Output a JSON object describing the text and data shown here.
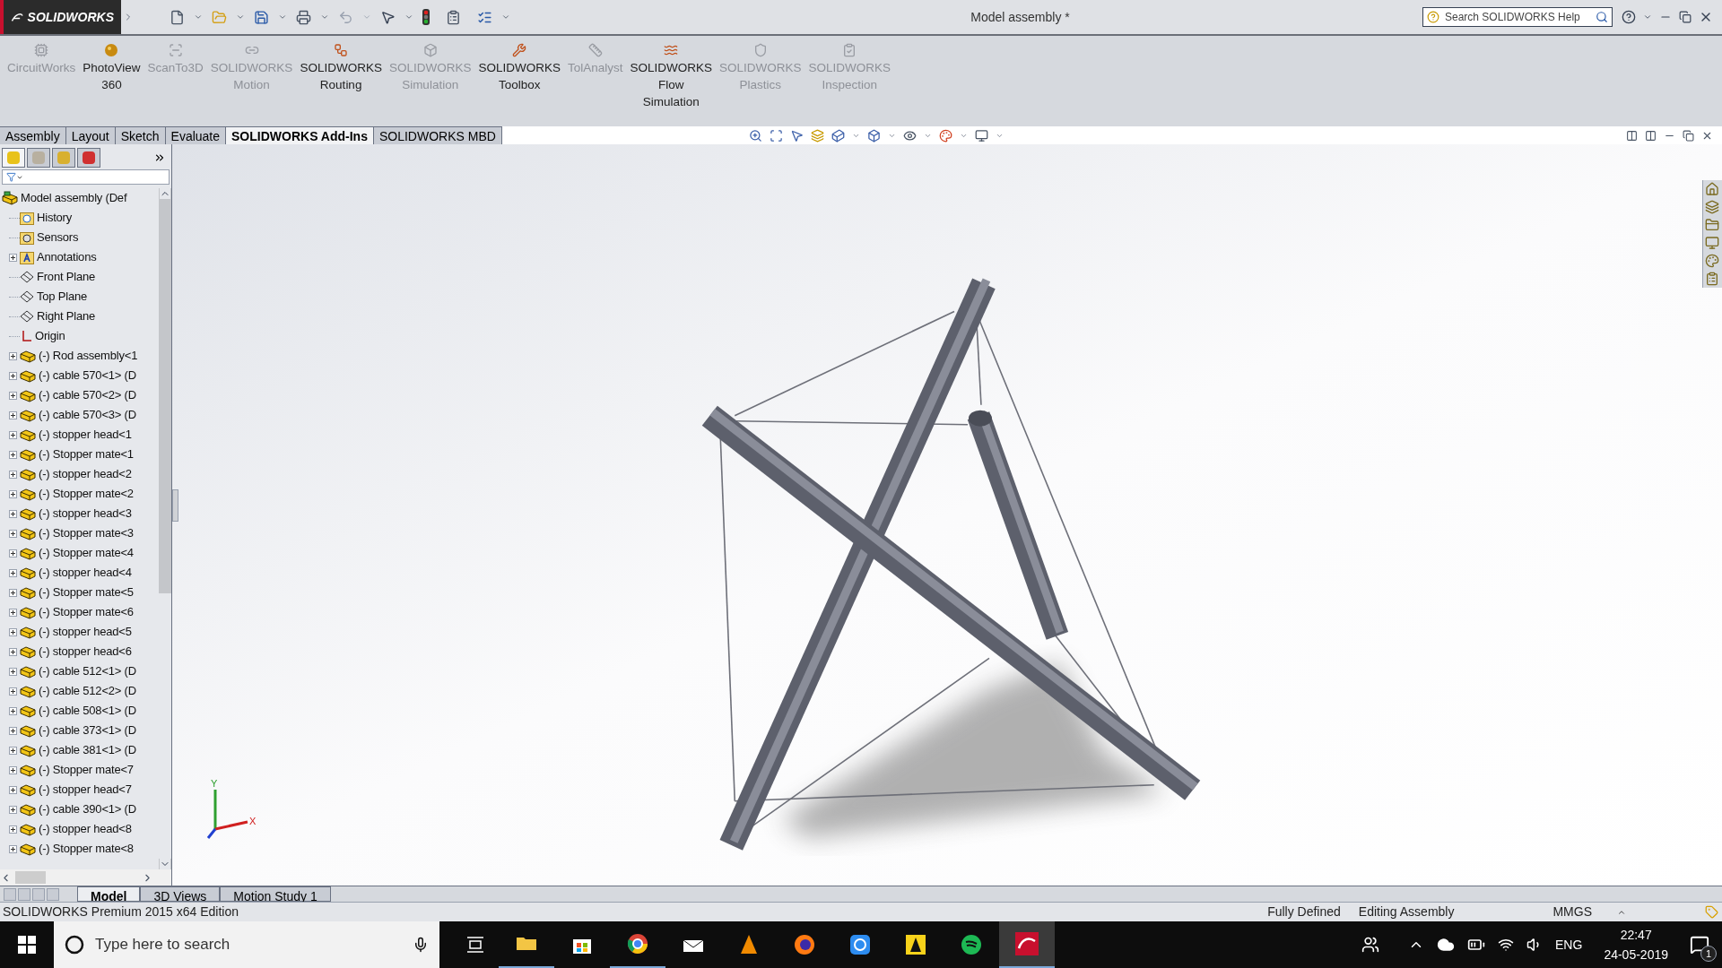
{
  "app": {
    "logo": "SOLIDWORKS"
  },
  "window": {
    "title": "Model assembly *"
  },
  "help_search": {
    "placeholder": "Search SOLIDWORKS Help"
  },
  "ribbon": [
    {
      "lines": [
        "CircuitWorks"
      ],
      "enabled": false
    },
    {
      "lines": [
        "PhotoView",
        "360"
      ],
      "enabled": true
    },
    {
      "lines": [
        "ScanTo3D"
      ],
      "enabled": false
    },
    {
      "lines": [
        "SOLIDWORKS",
        "Motion"
      ],
      "enabled": false
    },
    {
      "lines": [
        "SOLIDWORKS",
        "Routing"
      ],
      "enabled": true
    },
    {
      "lines": [
        "SOLIDWORKS",
        "Simulation"
      ],
      "enabled": false
    },
    {
      "lines": [
        "SOLIDWORKS",
        "Toolbox"
      ],
      "enabled": true
    },
    {
      "lines": [
        "TolAnalyst"
      ],
      "enabled": false
    },
    {
      "lines": [
        "SOLIDWORKS",
        "Flow",
        "Simulation"
      ],
      "enabled": true
    },
    {
      "lines": [
        "SOLIDWORKS",
        "Plastics"
      ],
      "enabled": false
    },
    {
      "lines": [
        "SOLIDWORKS",
        "Inspection"
      ],
      "enabled": false
    }
  ],
  "tabs": [
    {
      "label": "Assembly",
      "selected": false
    },
    {
      "label": "Layout",
      "selected": false
    },
    {
      "label": "Sketch",
      "selected": false
    },
    {
      "label": "Evaluate",
      "selected": false
    },
    {
      "label": "SOLIDWORKS Add-Ins",
      "selected": true
    },
    {
      "label": "SOLIDWORKS MBD",
      "selected": false
    }
  ],
  "feature_tree": {
    "items": [
      {
        "label": "Model assembly  (Def",
        "kind": "assembly",
        "expandable": false,
        "children": [
          {
            "label": "History",
            "kind": "history",
            "expandable": false
          },
          {
            "label": "Sensors",
            "kind": "sensors",
            "expandable": false
          },
          {
            "label": "Annotations",
            "kind": "annotations",
            "expandable": true
          },
          {
            "label": "Front Plane",
            "kind": "plane",
            "expandable": false
          },
          {
            "label": "Top Plane",
            "kind": "plane",
            "expandable": false
          },
          {
            "label": "Right Plane",
            "kind": "plane",
            "expandable": false
          },
          {
            "label": "Origin",
            "kind": "origin",
            "expandable": false
          },
          {
            "label": "(-) Rod assembly<1",
            "kind": "component",
            "expandable": true
          },
          {
            "label": "(-) cable 570<1> (D",
            "kind": "component",
            "expandable": true
          },
          {
            "label": "(-) cable 570<2> (D",
            "kind": "component",
            "expandable": true
          },
          {
            "label": "(-) cable 570<3> (D",
            "kind": "component",
            "expandable": true
          },
          {
            "label": "(-) stopper head<1",
            "kind": "component",
            "expandable": true
          },
          {
            "label": "(-) Stopper mate<1",
            "kind": "component",
            "expandable": true
          },
          {
            "label": "(-) stopper head<2",
            "kind": "component",
            "expandable": true
          },
          {
            "label": "(-) Stopper mate<2",
            "kind": "component",
            "expandable": true
          },
          {
            "label": "(-) stopper head<3",
            "kind": "component",
            "expandable": true
          },
          {
            "label": "(-) Stopper mate<3",
            "kind": "component",
            "expandable": true
          },
          {
            "label": "(-) Stopper mate<4",
            "kind": "component",
            "expandable": true
          },
          {
            "label": "(-) stopper head<4",
            "kind": "component",
            "expandable": true
          },
          {
            "label": "(-) Stopper mate<5",
            "kind": "component",
            "expandable": true
          },
          {
            "label": "(-) Stopper mate<6",
            "kind": "component",
            "expandable": true
          },
          {
            "label": "(-) stopper head<5",
            "kind": "component",
            "expandable": true
          },
          {
            "label": "(-) stopper head<6",
            "kind": "component",
            "expandable": true
          },
          {
            "label": "(-) cable 512<1> (D",
            "kind": "component",
            "expandable": true
          },
          {
            "label": "(-) cable 512<2> (D",
            "kind": "component",
            "expandable": true
          },
          {
            "label": "(-) cable 508<1> (D",
            "kind": "component",
            "expandable": true
          },
          {
            "label": "(-) cable 373<1> (D",
            "kind": "component",
            "expandable": true
          },
          {
            "label": "(-) cable 381<1> (D",
            "kind": "component",
            "expandable": true
          },
          {
            "label": "(-) Stopper mate<7",
            "kind": "component",
            "expandable": true
          },
          {
            "label": "(-) stopper head<7",
            "kind": "component",
            "expandable": true
          },
          {
            "label": "(-) cable 390<1> (D",
            "kind": "component",
            "expandable": true
          },
          {
            "label": "(-) stopper head<8",
            "kind": "component",
            "expandable": true
          },
          {
            "label": "(-) Stopper mate<8",
            "kind": "component",
            "expandable": true
          }
        ]
      }
    ]
  },
  "viewport": {
    "triad_labels": [
      "Y",
      "X"
    ]
  },
  "bottom_tabs": [
    {
      "label": "Model",
      "selected": true
    },
    {
      "label": "3D Views",
      "selected": false
    },
    {
      "label": "Motion Study 1",
      "selected": false
    }
  ],
  "status_bar": {
    "edition": "SOLIDWORKS Premium 2015 x64 Edition",
    "fields": [
      "Fully Defined",
      "Editing Assembly",
      "MMGS"
    ]
  },
  "taskbar": {
    "search": {
      "placeholder": "Type here to search"
    },
    "language": "ENG",
    "time": "22:47",
    "date": "24-05-2019",
    "notification_count": "1"
  }
}
